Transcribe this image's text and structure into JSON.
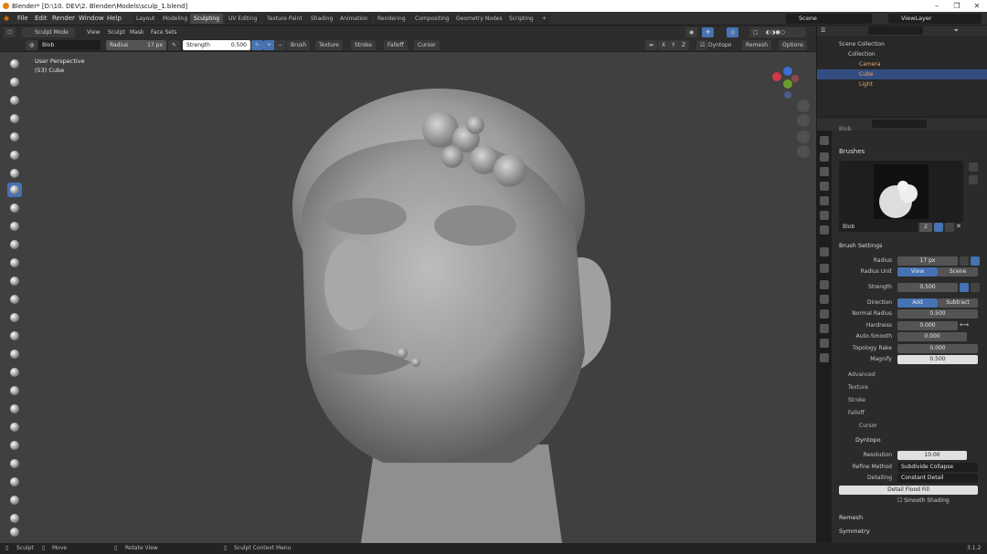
{
  "window": {
    "title": "Blender* [D:\\10. DEV\\2. Blender\\Models\\sculp_1.blend]"
  },
  "menu": [
    "File",
    "Edit",
    "Render",
    "Window",
    "Help"
  ],
  "workspaces": [
    "Layout",
    "Modeling",
    "Sculpting",
    "UV Editing",
    "Texture Paint",
    "Shading",
    "Animation",
    "Rendering",
    "Compositing",
    "Geometry Nodes",
    "Scripting"
  ],
  "active_workspace": "Sculpting",
  "scene": "Scene",
  "view_layer": "ViewLayer",
  "header": {
    "mode": "Sculpt Mode",
    "menus": [
      "View",
      "Sculpt",
      "Mask",
      "Face Sets"
    ],
    "brush_name": "Blob",
    "radius_label": "Radius",
    "radius_value": "17 px",
    "strength_label": "Strength",
    "strength_value": "0.500",
    "dropdowns": [
      "Brush",
      "Texture",
      "Stroke",
      "Falloff",
      "Cursor"
    ],
    "axes": [
      "X",
      "Y",
      "Z"
    ],
    "dyntopo": "Dyntopo",
    "remesh": "Remesh",
    "options": "Options"
  },
  "viewport": {
    "line1": "User Perspective",
    "line2": "(53) Cube"
  },
  "outliner": {
    "root": "Scene Collection",
    "collection": "Collection",
    "items": [
      "Camera",
      "Cube",
      "Light"
    ],
    "selected": "Cube"
  },
  "properties": {
    "brush_label": "Blob",
    "brushes_title": "Brushes",
    "brush_users": "2",
    "brush_settings_title": "Brush Settings",
    "radius_label": "Radius",
    "radius_value": "17 px",
    "radius_unit_label": "Radius Unit",
    "radius_unit_view": "View",
    "radius_unit_scene": "Scene",
    "strength_label": "Strength",
    "strength_value": "0.500",
    "direction_label": "Direction",
    "direction_add": "Add",
    "direction_subtract": "Subtract",
    "normal_radius_label": "Normal Radius",
    "normal_radius_value": "0.500",
    "hardness_label": "Hardness",
    "hardness_value": "0.000",
    "auto_smooth_label": "Auto-Smooth",
    "auto_smooth_value": "0.000",
    "topology_rake_label": "Topology Rake",
    "topology_rake_value": "0.000",
    "magnify_label": "Magnify",
    "magnify_value": "0.500",
    "subpanels": [
      "Advanced",
      "Texture",
      "Stroke",
      "Falloff",
      "Cursor"
    ],
    "dyntopo_title": "Dyntopo",
    "resolution_label": "Resolution",
    "resolution_value": "10.00",
    "refine_method_label": "Refine Method",
    "refine_method_value": "Subdivide Collapse",
    "detailing_label": "Detailing",
    "detailing_value": "Constant Detail",
    "detail_flood_fill": "Detail Flood Fill",
    "smooth_shading": "Smooth Shading",
    "remesh_title": "Remesh",
    "symmetry_title": "Symmetry"
  },
  "status": {
    "sculpt": "Sculpt",
    "move": "Move",
    "rotate_view": "Rotate View",
    "context_menu": "Sculpt Context Menu",
    "version": "3.1.2"
  },
  "colors": {
    "accent": "#4772b3",
    "selection": "#334d80",
    "viewport_bg": "#404040"
  }
}
